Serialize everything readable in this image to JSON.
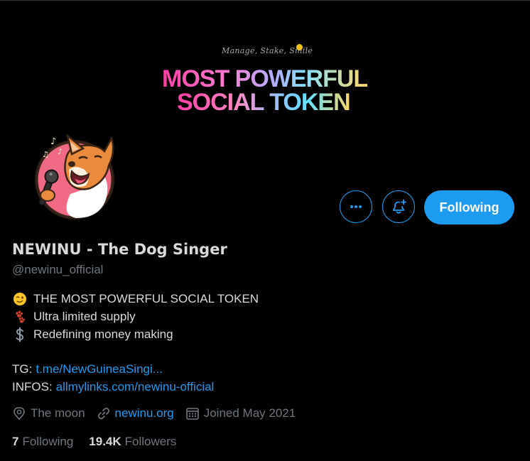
{
  "banner": {
    "tagline": "Manage, Stake, Smile",
    "headline_line1": "MOST POWERFUL",
    "headline_line2": "SOCIAL TOKEN"
  },
  "actions": {
    "follow_label": "Following",
    "more_icon": "more-icon",
    "notify_icon": "bell-plus-icon",
    "accent_color": "#1d9bf0"
  },
  "profile": {
    "name": "NEWINU - The Dog Singer",
    "handle": "@newinu_official",
    "bio": [
      {
        "icon": "winking-face-icon",
        "text": "THE MOST POWERFUL SOCIAL TOKEN"
      },
      {
        "icon": "paw-prints-icon",
        "text": "Ultra limited supply"
      },
      {
        "icon": "dollar-sign-icon",
        "text": "Redefining money making"
      }
    ],
    "links": [
      {
        "label": "TG:",
        "url_text": "t.me/NewGuineaSingi..."
      },
      {
        "label": "INFOS:",
        "url_text": "allmylinks.com/newinu-official"
      }
    ],
    "location": "The moon",
    "website": "newinu.org",
    "joined": "Joined May 2021"
  },
  "stats": {
    "following_count": "7",
    "following_label": "Following",
    "followers_count": "19.4K",
    "followers_label": "Followers"
  },
  "colors": {
    "background": "#000000",
    "text": "#d9d9d9",
    "muted": "#6e767d",
    "link": "#1d9bf0"
  }
}
